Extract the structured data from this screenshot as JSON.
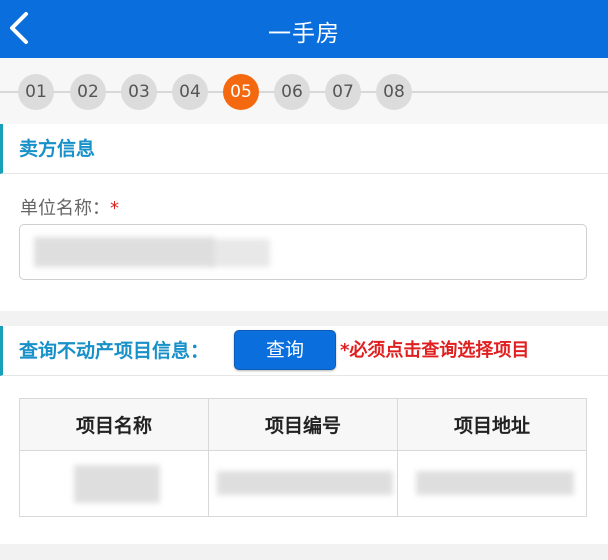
{
  "header": {
    "title": "一手房",
    "back_icon": "chevron-left-icon"
  },
  "steps": {
    "items": [
      "01",
      "02",
      "03",
      "04",
      "05",
      "06",
      "07",
      "08"
    ],
    "active": "05"
  },
  "seller": {
    "section_title": "卖方信息",
    "unit_name_label": "单位名称：",
    "required_mark": "*",
    "unit_name_value": ""
  },
  "query": {
    "label": "查询不动产项目信息：",
    "button_label": "查询",
    "note": "*必须点击查询选择项目"
  },
  "table": {
    "headers": [
      "项目名称",
      "项目编号",
      "项目地址"
    ],
    "rows": [
      [
        "",
        "",
        ""
      ]
    ]
  },
  "colors": {
    "header_bg": "#0a6fdc",
    "active_step": "#f4690f",
    "section_title": "#1890c8",
    "required": "#e02020"
  }
}
